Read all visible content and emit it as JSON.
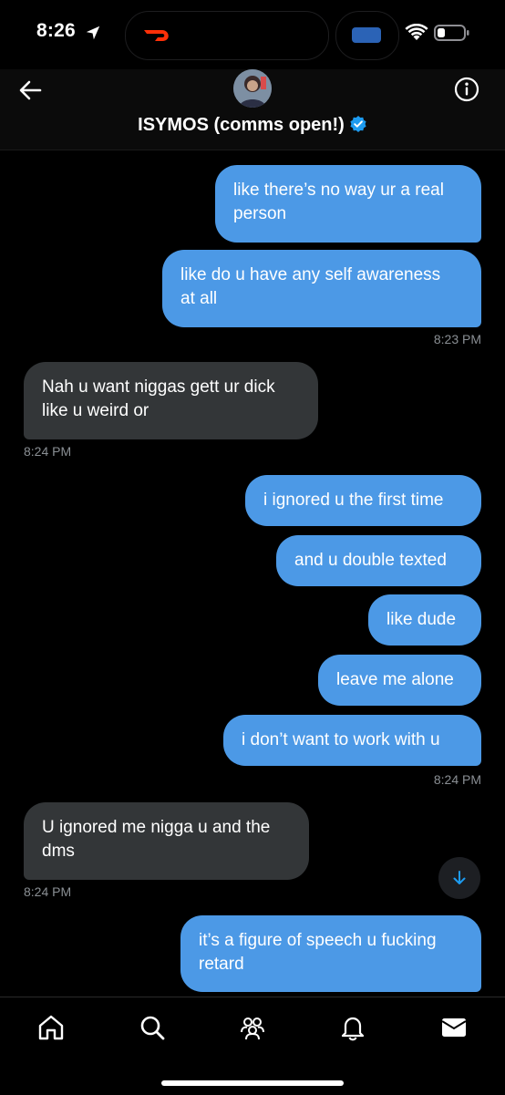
{
  "status_bar": {
    "time": "8:26"
  },
  "header": {
    "title": "ISYMOS (comms open!)"
  },
  "messages": [
    {
      "dir": "out",
      "text_lines": [
        "like there’s no way ur a real",
        "person"
      ]
    },
    {
      "dir": "out",
      "text_lines": [
        "like do u have any self awareness",
        "at all"
      ],
      "time": "8:23 PM"
    },
    {
      "dir": "in",
      "text_lines": [
        "Nah u want niggas gett ur dick",
        "like u weird or"
      ],
      "time": "8:24 PM"
    },
    {
      "dir": "out",
      "text": "i ignored u the first time"
    },
    {
      "dir": "out",
      "text": "and u double texted"
    },
    {
      "dir": "out",
      "text": "like dude"
    },
    {
      "dir": "out",
      "text": "leave me alone"
    },
    {
      "dir": "out",
      "text": "i don’t want to work with u",
      "time": "8:24 PM"
    },
    {
      "dir": "in",
      "text_lines": [
        "U ignored me nigga u and the",
        "dms"
      ],
      "time": "8:24 PM"
    },
    {
      "dir": "out",
      "text_lines": [
        "it’s a figure of speech u fucking",
        "retard"
      ]
    }
  ],
  "bottom_nav": [
    "home",
    "search",
    "communities",
    "notifications",
    "messages"
  ],
  "colors": {
    "outgoing_bubble": "#4c99e6",
    "incoming_bubble": "#333638",
    "verified": "#1d9bf0",
    "background": "#000000"
  }
}
